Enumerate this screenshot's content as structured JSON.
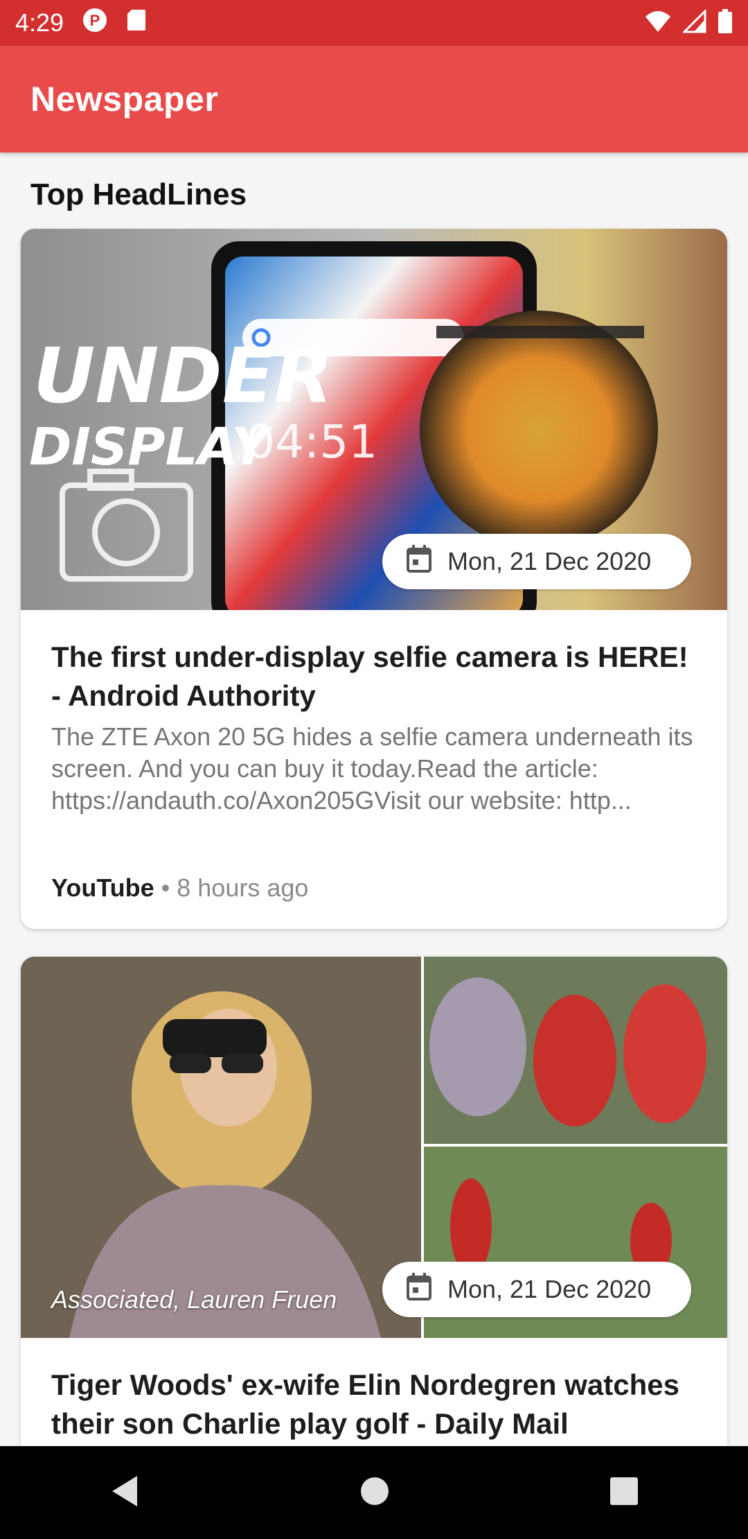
{
  "status_bar": {
    "time": "4:29",
    "icons": [
      "p-notification-icon",
      "sd-card-icon",
      "wifi-icon",
      "signal-icon",
      "battery-icon"
    ]
  },
  "app_bar": {
    "title": "Newspaper"
  },
  "section": {
    "title": "Top HeadLines"
  },
  "articles": [
    {
      "date": "Mon, 21 Dec 2020",
      "title": "The first under-display selfie camera is HERE! - Android Authority",
      "description": "The ZTE Axon 20 5G hides a selfie camera underneath its screen. And you can buy it today.Read the article: https://andauth.co/Axon205GVisit our website: http...",
      "source": "YouTube",
      "time_ago": "8 hours ago",
      "image_text": {
        "line1": "UNDER",
        "line2": "DISPLAY",
        "clock": "04:51"
      }
    },
    {
      "date": "Mon, 21 Dec 2020",
      "title": "Tiger Woods' ex-wife Elin Nordegren watches their son Charlie play golf - Daily Mail",
      "image_caption": "Associated, Lauren Fruen"
    }
  ],
  "colors": {
    "status_bar": "#d32f2f",
    "app_bar": "#e94b4b",
    "background": "#f5f5f5"
  },
  "nav_bar": {
    "icons": [
      "back-icon",
      "home-icon",
      "recents-icon"
    ]
  }
}
